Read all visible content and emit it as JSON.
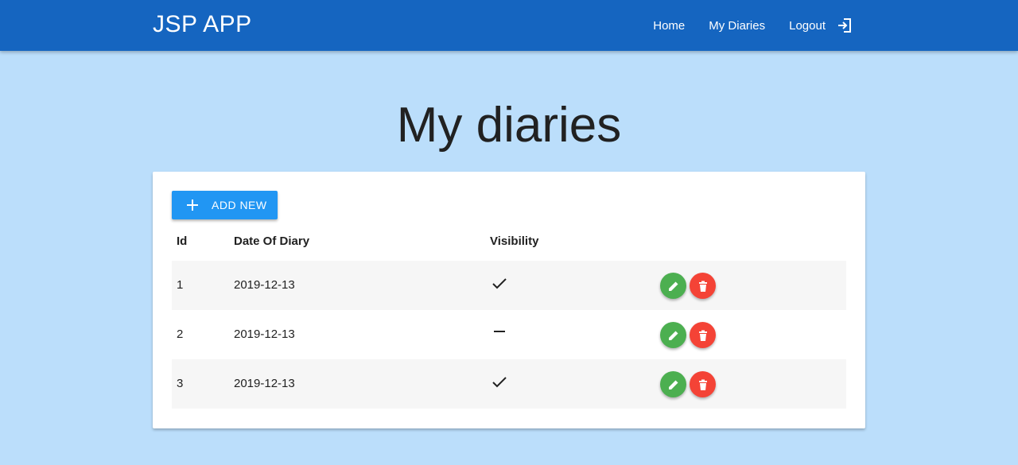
{
  "navbar": {
    "brand": "JSP APP",
    "links": [
      {
        "label": "Home"
      },
      {
        "label": "My Diaries"
      },
      {
        "label": "Logout"
      }
    ]
  },
  "page": {
    "title": "My diaries"
  },
  "toolbar": {
    "add_label": "ADD NEW"
  },
  "table": {
    "headers": [
      "Id",
      "Date Of Diary",
      "Visibility"
    ],
    "rows": [
      {
        "id": "1",
        "date": "2019-12-13",
        "visibility": "check-icon"
      },
      {
        "id": "2",
        "date": "2019-12-13",
        "visibility": "dash-icon"
      },
      {
        "id": "3",
        "date": "2019-12-13",
        "visibility": "check-icon"
      }
    ]
  },
  "colors": {
    "navbar": "#1565c0",
    "background": "#bbdefb",
    "primary_button": "#2196f3",
    "edit_button": "#4caf50",
    "delete_button": "#f44336"
  }
}
